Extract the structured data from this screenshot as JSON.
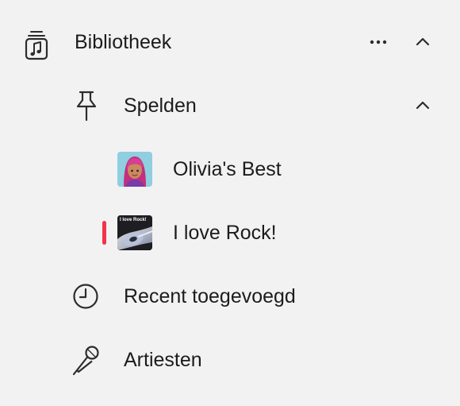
{
  "colors": {
    "background": "#f2f2f2",
    "text": "#1c1c1e",
    "icon": "#2c2c2e",
    "accent": "#f2334b"
  },
  "library": {
    "title": "Bibliotheek",
    "icon": "music-library-icon",
    "more_icon": "ellipsis-icon",
    "collapse_icon": "chevron-up-icon"
  },
  "pins": {
    "title": "Spelden",
    "icon": "pin-icon",
    "collapse_icon": "chevron-up-icon",
    "items": [
      {
        "label": "Olivia's Best",
        "artwork": "memoji-avatar-artwork",
        "playing": false
      },
      {
        "label": "I love Rock!",
        "artwork": "guitar-album-artwork",
        "artwork_text": "I love Rock!",
        "playing": true
      }
    ]
  },
  "nav": [
    {
      "label": "Recent toegevoegd",
      "icon": "clock-icon"
    },
    {
      "label": "Artiesten",
      "icon": "microphone-icon"
    }
  ]
}
